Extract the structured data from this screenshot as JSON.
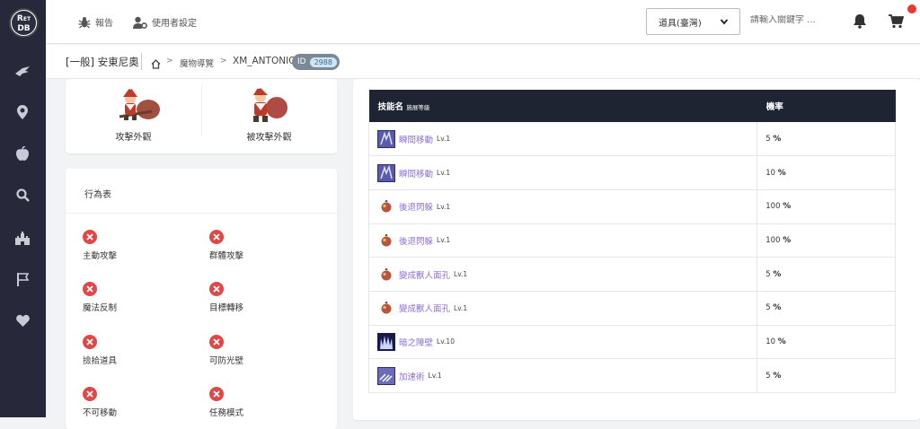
{
  "sidebar": {
    "logo_text": "RO\nDB",
    "icons": [
      "wing-icon",
      "map-pin-icon",
      "apple-icon",
      "search-icon",
      "castle-icon",
      "flag-icon",
      "heart-icon"
    ]
  },
  "topbar": {
    "report_label": "報告",
    "user_settings_label": "使用者設定",
    "select_value": "道具(臺灣)",
    "search_placeholder": "請輸入關鍵字 ..."
  },
  "breadcrumb": {
    "title": "[一般] 安東尼奧",
    "section": "魔物導覽",
    "current": "XM_ANTONIO",
    "id_label": "ID",
    "id_value": "2988"
  },
  "appearance": {
    "attack_label": "攻擊外觀",
    "damaged_label": "被攻擊外觀"
  },
  "behavior": {
    "title": "行為表",
    "items": [
      {
        "label": "主動攻擊",
        "enabled": false
      },
      {
        "label": "群體攻擊",
        "enabled": false
      },
      {
        "label": "魔法反制",
        "enabled": false
      },
      {
        "label": "目標轉移",
        "enabled": false
      },
      {
        "label": "撿拾道具",
        "enabled": false
      },
      {
        "label": "可防光壁",
        "enabled": false
      },
      {
        "label": "不可移動",
        "enabled": false
      },
      {
        "label": "任務模式",
        "enabled": false
      }
    ]
  },
  "skills": {
    "header_name": "技能名",
    "header_sub": "施展等級",
    "header_rate": "機率",
    "rows": [
      {
        "name": "瞬間移動",
        "lv": "Lv.1",
        "rate": "5",
        "unit": "%",
        "icon": "teleport-icon"
      },
      {
        "name": "瞬間移動",
        "lv": "Lv.1",
        "rate": "10",
        "unit": "%",
        "icon": "teleport-icon"
      },
      {
        "name": "後退閃躲",
        "lv": "Lv.1",
        "rate": "100",
        "unit": "%",
        "icon": "monster-skill-icon"
      },
      {
        "name": "後退閃躲",
        "lv": "Lv.1",
        "rate": "100",
        "unit": "%",
        "icon": "monster-skill-icon"
      },
      {
        "name": "變成獸人面孔",
        "lv": "Lv.1",
        "rate": "5",
        "unit": "%",
        "icon": "monster-skill-icon"
      },
      {
        "name": "變成獸人面孔",
        "lv": "Lv.1",
        "rate": "5",
        "unit": "%",
        "icon": "monster-skill-icon"
      },
      {
        "name": "暗之障壁",
        "lv": "Lv.10",
        "rate": "10",
        "unit": "%",
        "icon": "barrier-icon"
      },
      {
        "name": "加速術",
        "lv": "Lv.1",
        "rate": "5",
        "unit": "%",
        "icon": "speed-icon"
      }
    ]
  },
  "colors": {
    "sidebar": "#27293a",
    "accent_link": "#8b6fd6",
    "table_header": "#1f2433",
    "close_badge": "#e04848",
    "notify_dot": "#e53935"
  }
}
